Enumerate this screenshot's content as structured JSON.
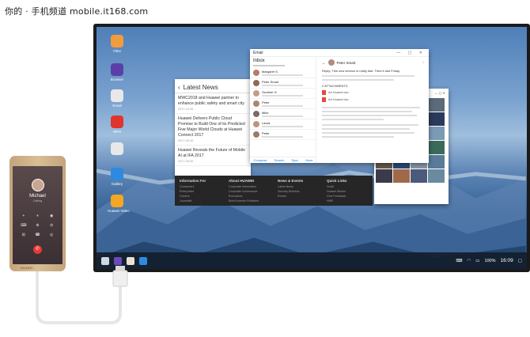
{
  "watermark": "你的 · 手机频道 mobile.it168.com",
  "desktop_icons": [
    {
      "label": "Files",
      "icon": "files-icon",
      "color": "#f39c3d"
    },
    {
      "label": "Browser",
      "icon": "browser-icon",
      "color": "#5b3fa8"
    },
    {
      "label": "Email",
      "icon": "email-icon",
      "color": "#e8e8e8"
    },
    {
      "label": "WPS",
      "icon": "wps-icon",
      "color": "#e0342c"
    },
    {
      "label": "",
      "icon": "file-icon",
      "color": "#e8e8e8"
    },
    {
      "label": "Gallery",
      "icon": "gallery-icon",
      "color": "#2d8ae0"
    },
    {
      "label": "Huawei Video",
      "icon": "video-icon",
      "color": "#f5a623"
    }
  ],
  "news": {
    "title": "Latest News",
    "items": [
      {
        "text": "MWC2018 and Huawei partner to enhance public safety and smart city",
        "date": "2017-10-00"
      },
      {
        "text": "Huawei Delivers Public Cloud Promise to Build One of its Predicted Five Major World Clouds at Huawei Connect 2017",
        "date": "2017-09-00"
      },
      {
        "text": "Huawei Reveals the Future of Mobile AI at IFA 2017",
        "date": "2017-09-00"
      }
    ]
  },
  "site_footer": [
    {
      "heading": "Information For",
      "links": [
        "Consumers",
        "Enterprises",
        "Carriers",
        "Journalist"
      ]
    },
    {
      "heading": "About HUAWEI",
      "links": [
        "Corporate Information",
        "Corporate Governance",
        "Executives",
        "Bond Investor Relations"
      ]
    },
    {
      "heading": "News & Events",
      "links": [
        "Latest News",
        "Security Bulletins",
        "Events"
      ]
    },
    {
      "heading": "Quick Links",
      "links": [
        "Vmall",
        "Huawei Mentor",
        "Give Feedback",
        "HMP"
      ]
    }
  ],
  "mail": {
    "window_title": "Email",
    "inbox": "Inbox",
    "list": [
      {
        "name": "Margaret S.",
        "color": "#b37c6b"
      },
      {
        "name": "Peter Smart",
        "color": "#8a6a5a"
      },
      {
        "name": "Gunther H.",
        "color": "#c59d85"
      },
      {
        "name": "Peter",
        "color": "#a98673"
      },
      {
        "name": "Mike",
        "color": "#7f6a62"
      },
      {
        "name": "Laura",
        "color": "#bb957f"
      },
      {
        "name": "Peter",
        "color": "#9c7a69"
      }
    ],
    "sender": "Peter Smart",
    "subject": "Reply: This new service is really fast. Tried it last Friday.",
    "attachments_label": "2 ATTACHMENTS",
    "attachments": [
      "Art.Huawei.doc",
      "Art.Huawei.doc"
    ],
    "bottom_bar": [
      "Compose",
      "Search",
      "Sync",
      "More"
    ]
  },
  "gallery": {
    "thumb_colors": [
      "#3a4a6a",
      "#2e4f7a",
      "#6a7a8a",
      "#5a6b7a",
      "#c87a3a",
      "#4a5a4a",
      "#7a8aa0",
      "#2a3a5a",
      "#9aa5b5",
      "#3a5a8a",
      "#5a3a3a",
      "#7a9ab5",
      "#c9a24a",
      "#4a6a9a",
      "#8a4a3a",
      "#3a6a5a",
      "#6a5a4a",
      "#2a4a7a",
      "#8a9aaa",
      "#5a7a9a",
      "#3a3a4a",
      "#a06a4a",
      "#4a5a7a",
      "#6a8aa0"
    ]
  },
  "taskbar": {
    "apps": [
      {
        "icon": "start-menu-icon",
        "color": "#cfd8e0"
      },
      {
        "icon": "browser-icon",
        "color": "#6a4ab8"
      },
      {
        "icon": "notes-icon",
        "color": "#e9e1d0"
      },
      {
        "icon": "gallery-icon",
        "color": "#2d8ae0"
      }
    ],
    "battery": "100%",
    "time": "16:09"
  },
  "phone": {
    "caller": "Michael",
    "status": "Calling",
    "keys": [
      "+",
      "⏸",
      "◉",
      "⌨",
      "⊕",
      "⊘",
      "⊞",
      "☎",
      "◎"
    ],
    "brand": "HUAWEI"
  }
}
